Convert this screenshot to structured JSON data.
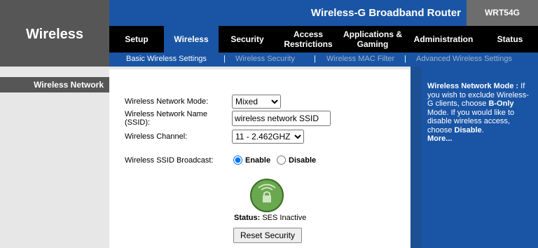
{
  "app": {
    "title": "Wireless",
    "product": "Wireless-G Broadband Router",
    "model": "WRT54G"
  },
  "tabs": [
    {
      "label": "Setup"
    },
    {
      "label": "Wireless"
    },
    {
      "label": "Security"
    },
    {
      "label": "Access Restrictions"
    },
    {
      "label": "Applications & Gaming"
    },
    {
      "label": "Administration"
    },
    {
      "label": "Status"
    }
  ],
  "subtabs": [
    "Basic Wireless Settings",
    "Wireless Security",
    "Wireless MAC Filter",
    "Advanced Wireless Settings"
  ],
  "sidebar": {
    "section": "Wireless Network"
  },
  "form": {
    "mode_label": "Wireless Network Mode:",
    "mode_value": "Mixed",
    "ssid_label": "Wireless Network Name (SSID):",
    "ssid_value": "wireless network SSID",
    "channel_label": "Wireless Channel:",
    "channel_value": "11 - 2.462GHZ",
    "broadcast_label": "Wireless SSID Broadcast:",
    "broadcast_enable": "Enable",
    "broadcast_disable": "Disable",
    "broadcast_selected": "Enable"
  },
  "ses": {
    "status_label": "Status:",
    "status_value": "SES Inactive",
    "reset_label": "Reset Security"
  },
  "help": {
    "title": "Wireless Network Mode :",
    "text1": "If you wish to exclude Wireless-G clients, choose",
    "bonly": "B-Only",
    "text2": "Mode. If you would like to disable wireless access, choose",
    "disable": "Disable",
    "more": "More..."
  },
  "colors": {
    "accent_blue": "#1a55a5",
    "tab_black": "#000000",
    "gray_dark": "#565656",
    "gray_light": "#e7e7e7"
  }
}
